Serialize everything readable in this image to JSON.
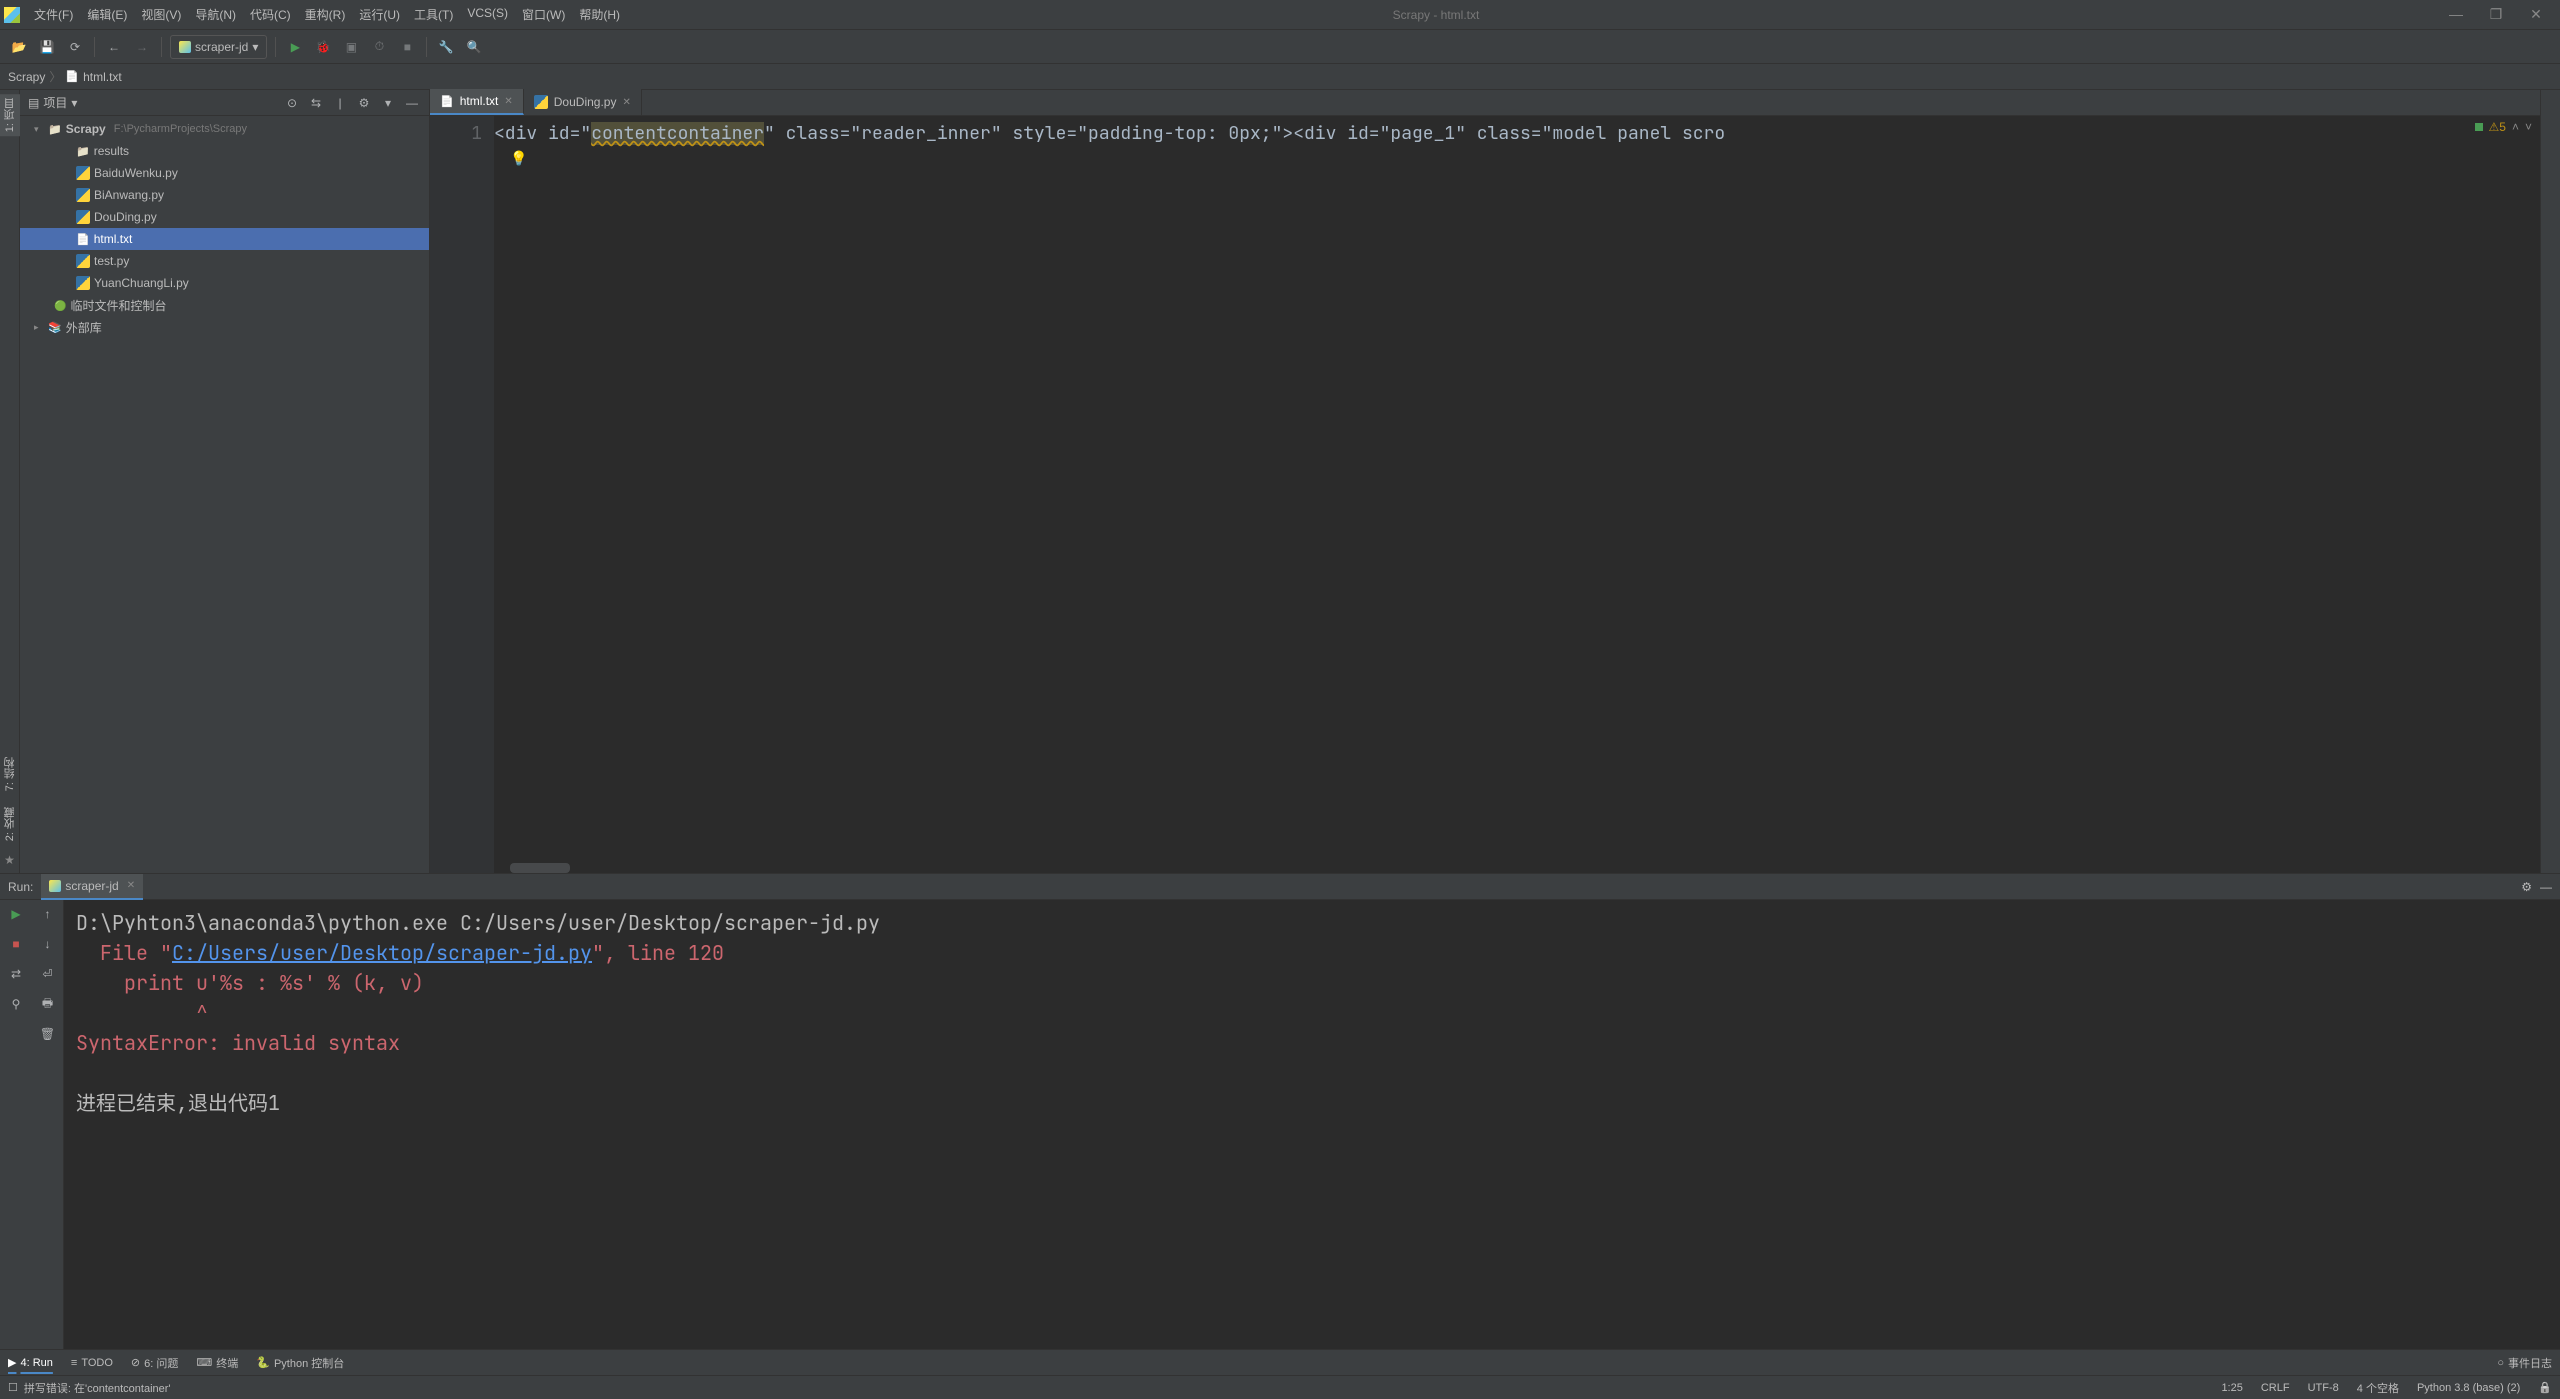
{
  "window": {
    "title": "Scrapy - html.txt",
    "menus": [
      "文件(F)",
      "编辑(E)",
      "视图(V)",
      "导航(N)",
      "代码(C)",
      "重构(R)",
      "运行(U)",
      "工具(T)",
      "VCS(S)",
      "窗口(W)",
      "帮助(H)"
    ]
  },
  "toolbar": {
    "run_config": "scraper-jd"
  },
  "breadcrumb": {
    "root": "Scrapy",
    "file": "html.txt"
  },
  "left_tabs": {
    "project": "1: 项目",
    "structure": "7: 结构",
    "favorites": "2: 收藏"
  },
  "project_panel": {
    "title": "项目",
    "root": "Scrapy",
    "root_path": "F:\\PycharmProjects\\Scrapy",
    "items": {
      "results": "results",
      "baidu": "BaiduWenku.py",
      "bianwang": "BiAnwang.py",
      "douding": "DouDing.py",
      "htmltxt": "html.txt",
      "testpy": "test.py",
      "yuanchuang": "YuanChuangLi.py"
    },
    "scratch": "临时文件和控制台",
    "external": "外部库"
  },
  "tabs": {
    "t1": "html.txt",
    "t2": "DouDing.py"
  },
  "editor": {
    "line_no": "1",
    "code_prefix": "<div id=\"",
    "code_warn": "contentcontainer",
    "code_mid": "\" class=\"reader_inner\" style=\"padding-top: 0px;\"><div id=\"page_1\" class=\"model panel scro",
    "indicator_count": "5"
  },
  "run": {
    "label": "Run:",
    "tab": "scraper-jd",
    "line1": "D:\\Pyhton3\\anaconda3\\python.exe C:/Users/user/Desktop/scraper-jd.py",
    "line2a": "  File \"",
    "line2link": "C:/Users/user/Desktop/scraper-jd.py",
    "line2b": "\", line 120",
    "line3": "    print u'%s : %s' % (k, v)",
    "line4": "          ^",
    "line5": "SyntaxError: invalid syntax",
    "line6": "",
    "line7": "进程已结束,退出代码1"
  },
  "bottom": {
    "run": "4: Run",
    "todo": "TODO",
    "problems": "6: 问题",
    "terminal": "终端",
    "pyconsole": "Python 控制台",
    "eventlog": "事件日志"
  },
  "status": {
    "left": "拼写错误: 在'contentcontainer'",
    "pos": "1:25",
    "eol": "CRLF",
    "enc": "UTF-8",
    "indent": "4 个空格",
    "interp": "Python 3.8 (base) (2)"
  }
}
